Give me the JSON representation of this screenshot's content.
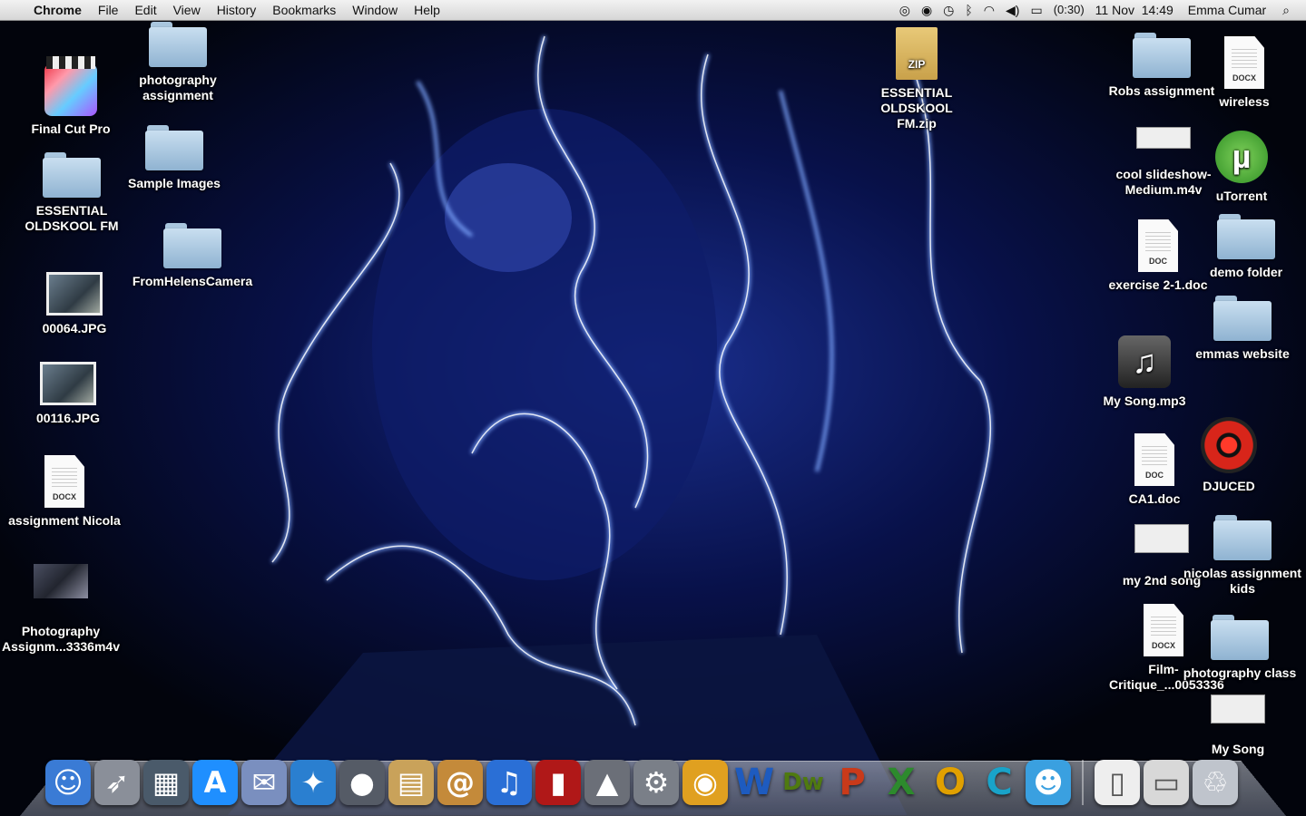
{
  "menubar": {
    "apple_icon": "apple-icon",
    "app_name": "Chrome",
    "menus": [
      "File",
      "Edit",
      "View",
      "History",
      "Bookmarks",
      "Window",
      "Help"
    ],
    "battery_text": "(0:30)",
    "datetime": "11 Nov  14:49",
    "user": "Emma Cumar"
  },
  "desktop": {
    "left": [
      {
        "label": "Final Cut Pro",
        "kind": "app-fcp"
      },
      {
        "label": "ESSENTIAL OLDSKOOL FM",
        "kind": "folder"
      },
      {
        "label": "00064.JPG",
        "kind": "image"
      },
      {
        "label": "00116.JPG",
        "kind": "image"
      },
      {
        "label": "assignment Nicola",
        "kind": "docx"
      },
      {
        "label": "Photography Assignm...3336m4v",
        "kind": "video"
      }
    ],
    "center": [
      {
        "label": "photography assignment",
        "kind": "folder"
      },
      {
        "label": "Sample Images",
        "kind": "folder"
      },
      {
        "label": "FromHelensCamera",
        "kind": "folder"
      },
      {
        "label": "ESSENTIAL OLDSKOOL FM.zip",
        "kind": "zip"
      }
    ],
    "right": [
      {
        "label": "Robs assignment",
        "kind": "folder"
      },
      {
        "label": "wireless",
        "kind": "docx"
      },
      {
        "label": "cool slideshow-Medium.m4v",
        "kind": "video"
      },
      {
        "label": "uTorrent",
        "kind": "app-utorrent"
      },
      {
        "label": "exercise 2-1.doc",
        "kind": "doc"
      },
      {
        "label": "demo folder",
        "kind": "folder"
      },
      {
        "label": "emmas website",
        "kind": "folder"
      },
      {
        "label": "My Song.mp3",
        "kind": "audio"
      },
      {
        "label": "DJUCED",
        "kind": "app-djuced"
      },
      {
        "label": "CA1.doc",
        "kind": "doc"
      },
      {
        "label": "my 2nd song",
        "kind": "video"
      },
      {
        "label": "nicolas assignment kids",
        "kind": "folder"
      },
      {
        "label": "Film-Critique_...0053336",
        "kind": "docx"
      },
      {
        "label": "photography class",
        "kind": "folder"
      },
      {
        "label": "My Song",
        "kind": "video"
      }
    ],
    "zip_tag": "ZIP",
    "doc_tag": "DOC",
    "docx_tag": "DOCX"
  },
  "dock": {
    "items": [
      {
        "name": "Finder",
        "icon": "finder-icon",
        "color": "#3a7bd5"
      },
      {
        "name": "Launchpad",
        "icon": "rocket-icon",
        "color": "#8a8f99"
      },
      {
        "name": "Mission Control",
        "icon": "mission-control-icon",
        "color": "#4a5a6a"
      },
      {
        "name": "App Store",
        "icon": "app-store-icon",
        "color": "#1f8fff"
      },
      {
        "name": "Mail",
        "icon": "mail-icon",
        "color": "#7a8fbf"
      },
      {
        "name": "Safari",
        "icon": "safari-icon",
        "color": "#2a7fd0"
      },
      {
        "name": "FaceTime",
        "icon": "camera-icon",
        "color": "#555b66"
      },
      {
        "name": "Preview",
        "icon": "preview-icon",
        "color": "#c9a25a"
      },
      {
        "name": "Address Book",
        "icon": "contacts-icon",
        "color": "#c48a3a"
      },
      {
        "name": "iTunes",
        "icon": "itunes-icon",
        "color": "#2a6fd6"
      },
      {
        "name": "Photo Booth",
        "icon": "photobooth-icon",
        "color": "#b01818"
      },
      {
        "name": "iPhoto",
        "icon": "iphoto-icon",
        "color": "#6b6f78"
      },
      {
        "name": "System Preferences",
        "icon": "gear-icon",
        "color": "#7a7f88"
      },
      {
        "name": "Chrome",
        "icon": "chrome-icon",
        "color": "#e0a020"
      },
      {
        "name": "Word",
        "icon": "word-icon",
        "color": "#1e5bbf",
        "letter": "W"
      },
      {
        "name": "Dreamweaver",
        "icon": "dreamweaver-icon",
        "color": "#4f7a10",
        "letter": "Dw"
      },
      {
        "name": "PowerPoint",
        "icon": "powerpoint-icon",
        "color": "#c93a1a",
        "letter": "P"
      },
      {
        "name": "Excel",
        "icon": "excel-icon",
        "color": "#2d8a2d",
        "letter": "X"
      },
      {
        "name": "Outlook",
        "icon": "outlook-icon",
        "color": "#e0a000",
        "letter": "O"
      },
      {
        "name": "Communicator",
        "icon": "communicator-icon",
        "color": "#19a3c9",
        "letter": "C"
      },
      {
        "name": "Messenger",
        "icon": "messenger-icon",
        "color": "#3aa0e0"
      },
      {
        "name": "Document",
        "icon": "docx-icon",
        "color": "#eeeeee"
      },
      {
        "name": "Downloads",
        "icon": "downloads-icon",
        "color": "#d8d8d8"
      },
      {
        "name": "Trash",
        "icon": "trash-icon",
        "color": "#bfc4cc"
      }
    ]
  }
}
